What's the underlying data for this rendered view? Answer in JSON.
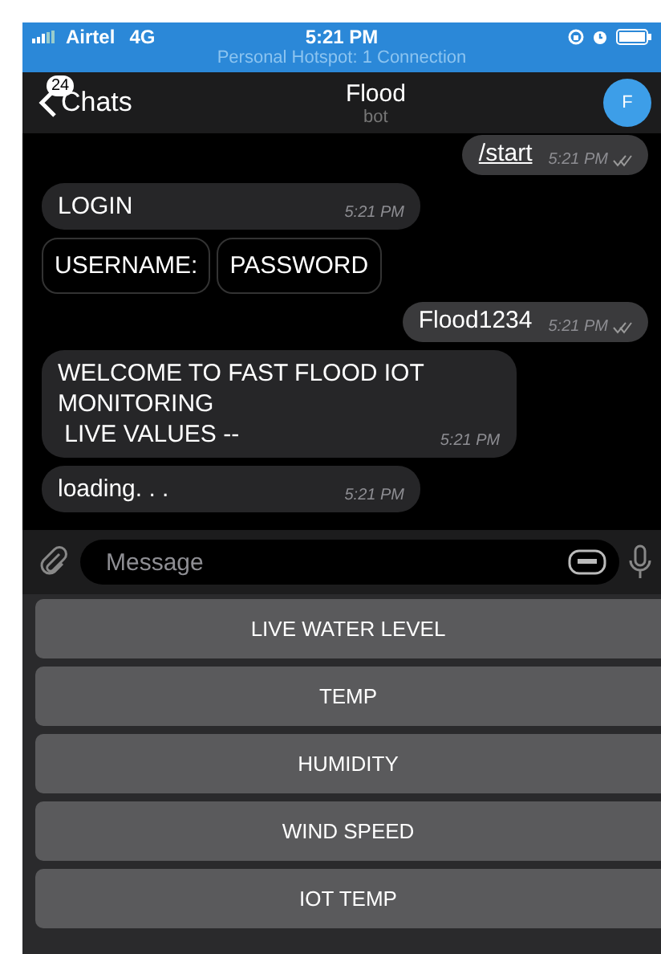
{
  "status_bar": {
    "carrier": "Airtel",
    "network": "4G",
    "time": "5:21 PM",
    "hotspot": "Personal Hotspot: 1 Connection"
  },
  "header": {
    "unread_count": "24",
    "back_label": "Chats",
    "title": "Flood",
    "subtitle": "bot",
    "avatar_letter": "F"
  },
  "messages": [
    {
      "kind": "outgoing",
      "text": "/start",
      "time": "5:21 PM",
      "read": true,
      "underlined": true
    },
    {
      "kind": "incoming",
      "text": "LOGIN",
      "time": "5:21 PM"
    },
    {
      "kind": "buttons",
      "buttons": [
        "USERNAME:",
        "PASSWORD"
      ]
    },
    {
      "kind": "outgoing",
      "text": "Flood1234",
      "time": "5:21 PM",
      "read": true,
      "underlined": false
    },
    {
      "kind": "incoming",
      "text": "WELCOME TO FAST FLOOD IOT\nMONITORING\n LIVE VALUES --",
      "time": "5:21 PM"
    },
    {
      "kind": "incoming",
      "text": "loading. . .",
      "time": "5:21 PM"
    }
  ],
  "composer": {
    "placeholder": "Message"
  },
  "keyboard": [
    "LIVE WATER LEVEL",
    "TEMP",
    "HUMIDITY",
    "WIND SPEED",
    "IOT TEMP"
  ]
}
